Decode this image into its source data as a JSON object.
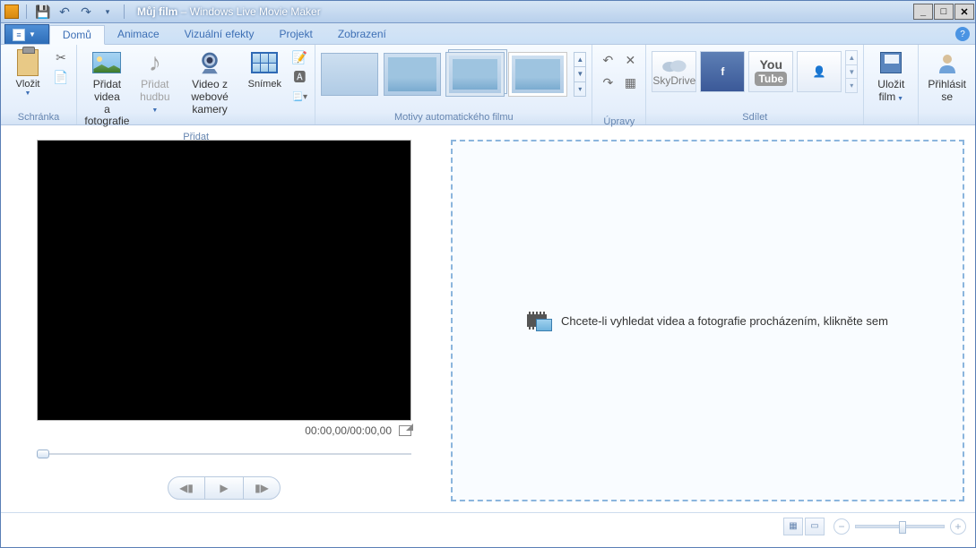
{
  "title": {
    "doc": "Můj film",
    "sep": " – ",
    "app": "Windows Live Movie Maker"
  },
  "tabs": {
    "home": "Domů",
    "animations": "Animace",
    "visual_effects": "Vizuální efekty",
    "project": "Projekt",
    "view": "Zobrazení"
  },
  "groups": {
    "clipboard": "Schránka",
    "add": "Přidat",
    "themes": "Motivy automatického filmu",
    "editing": "Úpravy",
    "share": "Sdílet"
  },
  "buttons": {
    "paste": "Vložit",
    "add_media_l1": "Přidat videa",
    "add_media_l2": "a fotografie",
    "add_music_l1": "Přidat",
    "add_music_l2": "hudbu",
    "webcam_l1": "Video z webové",
    "webcam_l2": "kamery",
    "snapshot": "Snímek",
    "skydrive": "SkyDrive",
    "save_movie_l1": "Uložit",
    "save_movie_l2": "film",
    "signin_l1": "Přihlásit",
    "signin_l2": "se"
  },
  "share": {
    "youtube_you": "You",
    "youtube_tube": "Tube"
  },
  "preview": {
    "time": "00:00,00/00:00,00"
  },
  "storyboard": {
    "hint": "Chcete-li vyhledat videa a fotografie procházením, klikněte sem"
  }
}
